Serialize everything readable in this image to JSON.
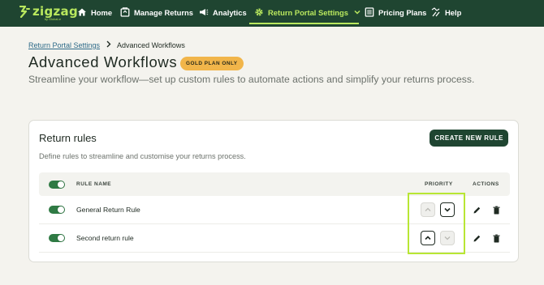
{
  "nav": {
    "logo": "zigzag",
    "logo_sub": "by Global-e",
    "items": [
      {
        "label": "Home",
        "icon": "home-icon"
      },
      {
        "label": "Manage Returns",
        "icon": "returns-icon"
      },
      {
        "label": "Analytics",
        "icon": "megaphone-icon"
      },
      {
        "label": "Return Portal Settings",
        "icon": "gear-icon",
        "active": true
      },
      {
        "label": "Pricing Plans",
        "icon": "list-icon"
      },
      {
        "label": "Help",
        "icon": "help-icon"
      }
    ],
    "accent": "#b9e85e",
    "background": "#1f4531"
  },
  "breadcrumb": {
    "parent": "Return Portal Settings",
    "current": "Advanced Workflows"
  },
  "page": {
    "title": "Advanced Workflows",
    "badge": "GOLD PLAN ONLY",
    "subtitle": "Streamline your workflow—set up custom rules to automate actions and simplify your returns process."
  },
  "card": {
    "title": "Return rules",
    "description": "Define rules to streamline and customise your returns process.",
    "create_button": "CREATE NEW RULE",
    "table": {
      "headers": {
        "rule_name": "RULE NAME",
        "priority": "PRIORITY",
        "actions": "ACTIONS"
      },
      "rows": [
        {
          "name": "General Return Rule",
          "enabled": true,
          "up_enabled": false,
          "down_enabled": true
        },
        {
          "name": "Second return rule",
          "enabled": true,
          "up_enabled": true,
          "down_enabled": false
        }
      ]
    }
  },
  "colors": {
    "toggle_on": "#2f7a44",
    "badge": "#f1b54a",
    "highlight": "#b8e634"
  }
}
